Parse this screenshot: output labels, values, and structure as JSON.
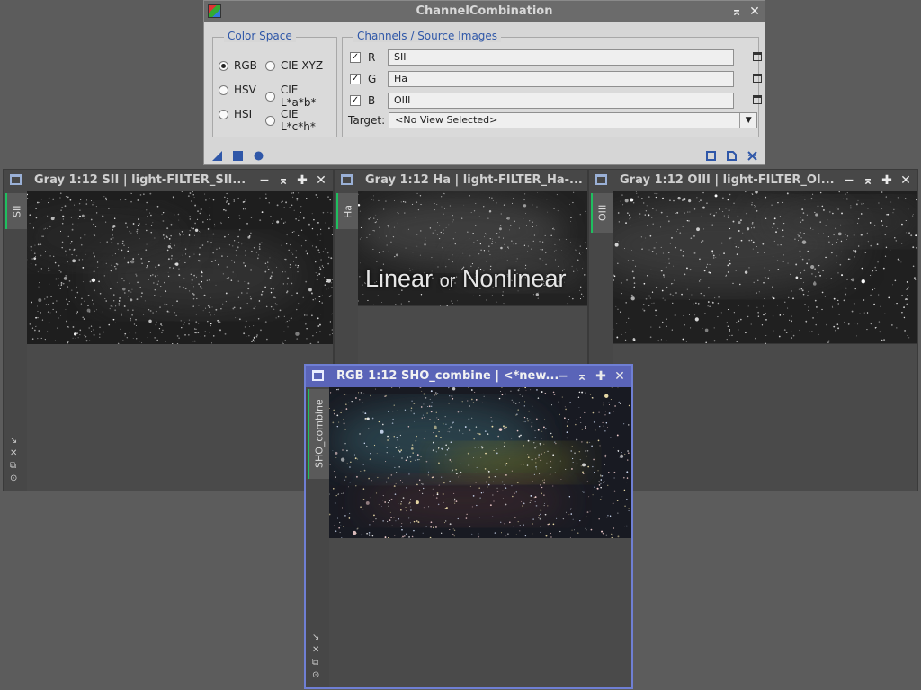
{
  "dialog": {
    "title": "ChannelCombination",
    "color_space": {
      "legend": "Color Space",
      "options": [
        "RGB",
        "CIE XYZ",
        "HSV",
        "CIE L*a*b*",
        "HSI",
        "CIE L*c*h*"
      ],
      "selected": "RGB"
    },
    "channels": {
      "legend": "Channels / Source Images",
      "rows": [
        {
          "label": "R",
          "checked": true,
          "value": "SII"
        },
        {
          "label": "G",
          "checked": true,
          "value": "Ha"
        },
        {
          "label": "B",
          "checked": true,
          "value": "OIII"
        }
      ],
      "target_label": "Target:",
      "target_value": "<No View Selected>"
    }
  },
  "windows": {
    "sii": {
      "title": "Gray 1:12 SII | light-FILTER_SII...",
      "tab": "SII"
    },
    "ha": {
      "title": "Gray 1:12 Ha | light-FILTER_Ha-...",
      "tab": "Ha",
      "overlay_big1": "Linear",
      "overlay_small": "or",
      "overlay_big2": "Nonlinear"
    },
    "oiii": {
      "title": "Gray 1:12 OIII | light-FILTER_OI...",
      "tab": "OIII"
    },
    "sho": {
      "title": "RGB 1:12 SHO_combine | <*new...",
      "tab": "SHO_combine"
    }
  },
  "icons": {
    "minimize": "−",
    "shade": "⌅",
    "maximize": "✚",
    "close": "✕"
  },
  "colors": {
    "accent_blue": "#2f57a8",
    "active_window_border": "#6f7fd4",
    "tab_green": "#1fbf5f"
  }
}
